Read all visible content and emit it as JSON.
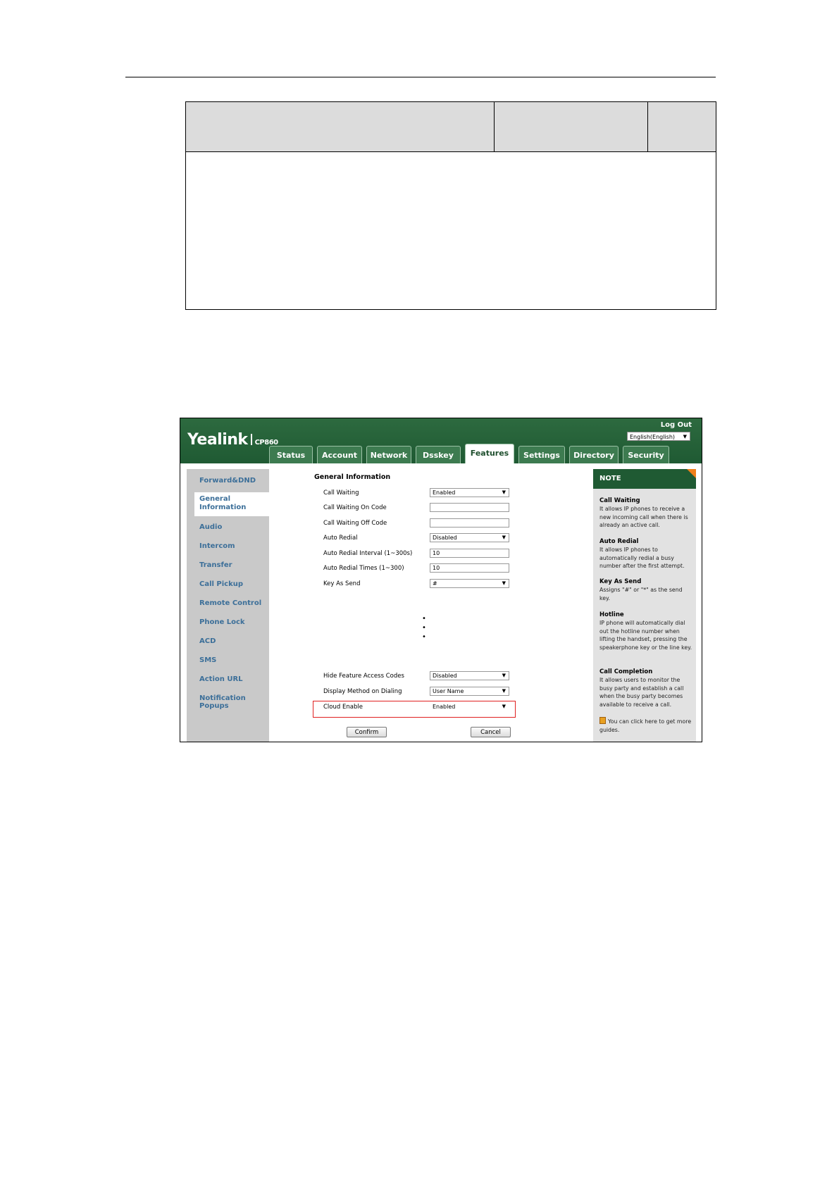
{
  "ui": {
    "logo": "Yealink",
    "model": "CP860",
    "logout": "Log Out",
    "language": "English(English)",
    "tabs": [
      "Status",
      "Account",
      "Network",
      "Dsskey",
      "Features",
      "Settings",
      "Directory",
      "Security"
    ],
    "active_tab": "Features",
    "nav": [
      "Forward&DND",
      "General Information",
      "Audio",
      "Intercom",
      "Transfer",
      "Call Pickup",
      "Remote Control",
      "Phone Lock",
      "ACD",
      "SMS",
      "Action URL",
      "Notification Popups"
    ],
    "nav_active": "General Information",
    "section_title": "General Information",
    "fields": [
      {
        "label": "Call Waiting",
        "value": "Enabled",
        "type": "select"
      },
      {
        "label": "Call Waiting On Code",
        "value": "",
        "type": "text"
      },
      {
        "label": "Call Waiting Off Code",
        "value": "",
        "type": "text"
      },
      {
        "label": "Auto Redial",
        "value": "Disabled",
        "type": "select"
      },
      {
        "label": "Auto Redial Interval (1~300s)",
        "value": "10",
        "type": "text"
      },
      {
        "label": "Auto Redial Times (1~300)",
        "value": "10",
        "type": "text"
      },
      {
        "label": "Key As Send",
        "value": "#",
        "type": "select"
      },
      {
        "label": "Hide Feature Access Codes",
        "value": "Disabled",
        "type": "select"
      },
      {
        "label": "Display Method on Dialing",
        "value": "User Name",
        "type": "select"
      },
      {
        "label": "Cloud Enable",
        "value": "Enabled",
        "type": "select"
      }
    ],
    "confirm": "Confirm",
    "cancel": "Cancel",
    "note": {
      "title": "NOTE",
      "items": [
        {
          "title": "Call Waiting",
          "body": "It allows IP phones to receive a new incoming call when there is already an active call."
        },
        {
          "title": "Auto Redial",
          "body": "It allows IP phones to automatically redial a busy number after the first attempt."
        },
        {
          "title": "Key As Send",
          "body": "Assigns \"#\" or \"*\" as the send key."
        },
        {
          "title": "Hotline",
          "body": "IP phone will automatically dial out the hotline number when lifting the handset, pressing the speakerphone key or the line key."
        },
        {
          "title": "Call Completion",
          "body": "It allows users to monitor the busy party and establish a call when the busy party becomes available to receive a call."
        }
      ],
      "footer": "You can click here to get more guides."
    }
  }
}
